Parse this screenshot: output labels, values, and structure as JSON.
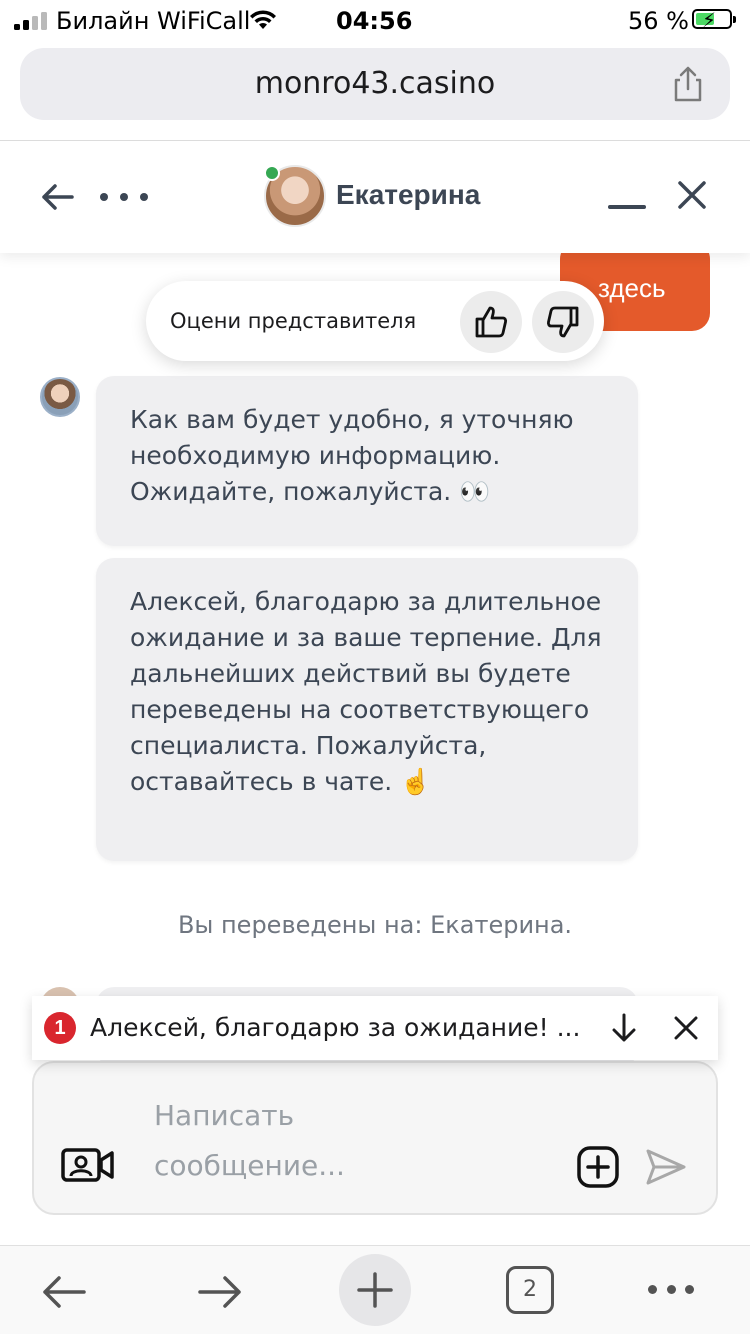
{
  "status_bar": {
    "carrier": "Билайн WiFiCall",
    "time": "04:56",
    "battery": "56 %",
    "battery_level": 0.56,
    "signal_bars": 2
  },
  "browser": {
    "url": "monro43.casino",
    "open_tabs": "2",
    "icons": [
      "share-icon",
      "back-arrow-icon",
      "forward-arrow-icon",
      "plus-icon",
      "more-icon"
    ]
  },
  "chat": {
    "agent_name": "Екатерина",
    "agent_online": true,
    "outgoing_message_fragment": "здесь",
    "rating": {
      "label": "Оцени представителя",
      "icons": [
        "thumbs-up-icon",
        "thumbs-down-icon"
      ]
    },
    "messages": [
      {
        "text": "Как вам будет удобно, я уточняю необходимую информацию. Ожидайте, пожалуйста. 👀"
      },
      {
        "text": "Алексей, благодарю за длительное ожидание и за ваше терпение. Для дальнейших действий вы будете переведены на соответствующего специалиста. Пожалуйста, оставайтесь в чате. ☝️"
      }
    ],
    "system_message": "Вы переведены на: Екатерина.",
    "notification": {
      "count": "1",
      "text": "Алексей, благодарю за ожидание! ..."
    },
    "composer": {
      "placeholder": "Написать\nсообщение..."
    },
    "colors": {
      "accent": "#e45a2b",
      "online": "#35a853",
      "badge": "#d9262e",
      "bubble": "#efeff1",
      "text": "#3c4654"
    }
  }
}
